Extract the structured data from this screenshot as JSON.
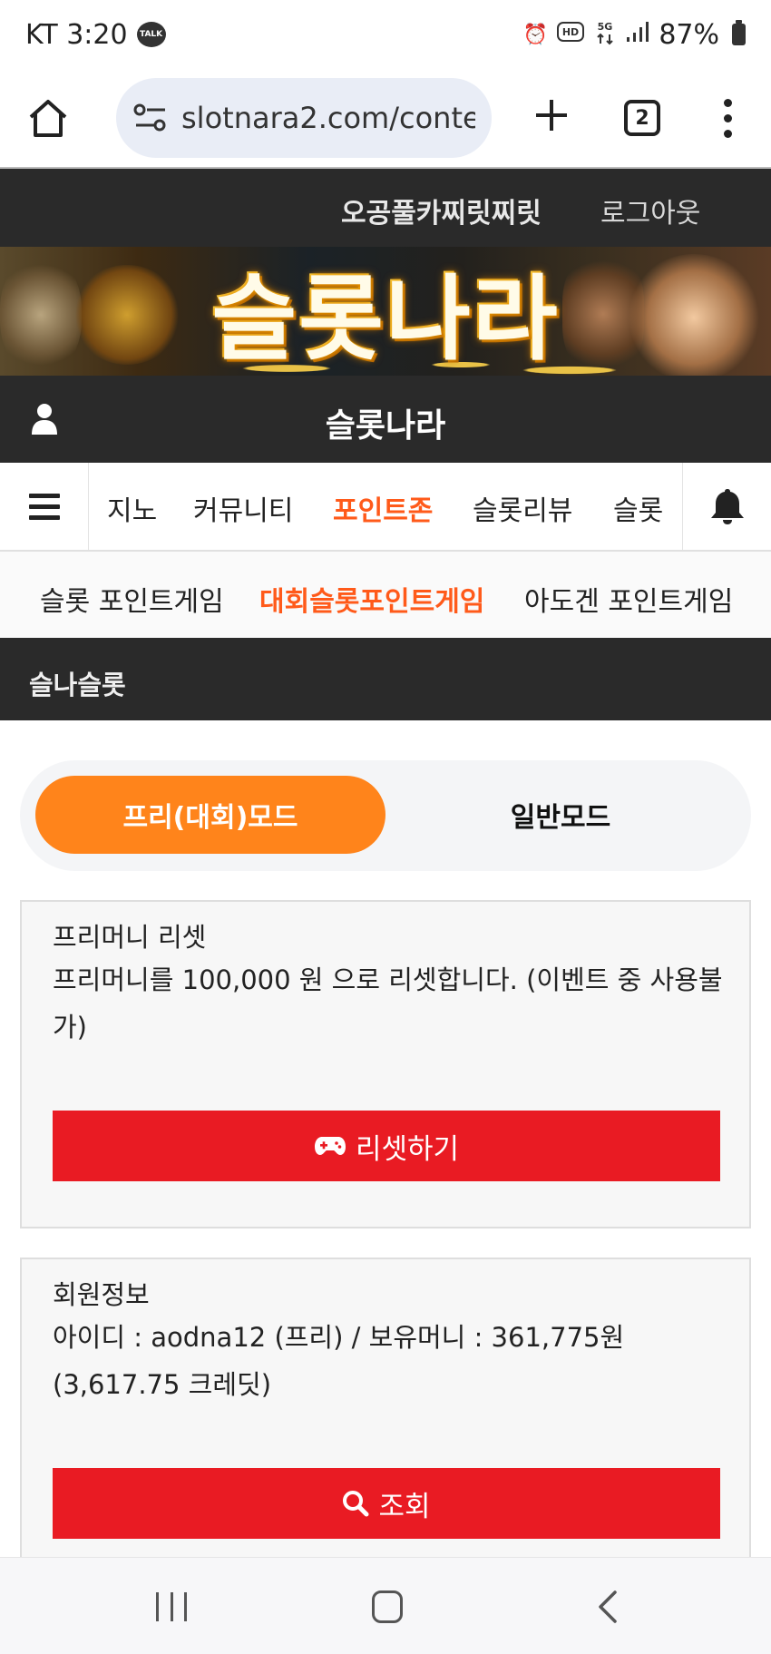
{
  "status_bar": {
    "carrier_time": "KT 3:20",
    "talk_badge": "TALK",
    "battery": "87%",
    "icons": [
      "talk-icon",
      "alarm-icon",
      "hd-icon",
      "5g-icon",
      "signal-icon",
      "battery-icon"
    ]
  },
  "browser": {
    "url": "slotnara2.com/conte",
    "tab_count": "2",
    "icons": [
      "home-icon",
      "site-settings-icon",
      "plus-icon",
      "tabs-icon",
      "more-icon"
    ]
  },
  "top_nav": {
    "link_1": "오공풀카찌릿찌릿",
    "link_2": "로그아웃"
  },
  "banner": {
    "title": "슬롯나라"
  },
  "site_header": {
    "title": "슬롯나라"
  },
  "main_nav": {
    "items": [
      {
        "label": "지노",
        "active": false
      },
      {
        "label": "커뮤니티",
        "active": false
      },
      {
        "label": "포인트존",
        "active": true
      },
      {
        "label": "슬롯리뷰",
        "active": false
      },
      {
        "label": "슬롯",
        "active": false
      }
    ]
  },
  "sub_nav": {
    "items": [
      {
        "label": "슬롯 포인트게임",
        "active": false
      },
      {
        "label": "대회슬롯포인트게임",
        "active": true
      },
      {
        "label": "아도겐 포인트게임",
        "active": false
      }
    ]
  },
  "section": {
    "title": "슬나슬롯"
  },
  "mode": {
    "free_label": "프리(대회)모드",
    "normal_label": "일반모드",
    "selected": "free"
  },
  "reset_card": {
    "title": "프리머니 리셋",
    "description": "프리머니를 100,000 원 으로 리셋합니다. (이벤트 중 사용불가)",
    "button_label": "리셋하기"
  },
  "member_card": {
    "title": "회원정보",
    "description": "아이디 : aodna12 (프리) / 보유머니 : 361,775원 (3,617.75 크레딧)",
    "button_label": "조회"
  },
  "colors": {
    "dark_bar": "#2a2a2a",
    "accent_orange": "#ff5a1a",
    "mode_orange": "#ff841b",
    "action_red": "#e91b23"
  }
}
